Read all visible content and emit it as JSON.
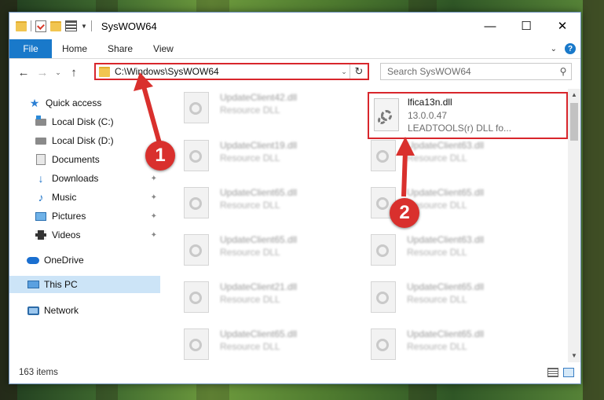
{
  "titlebar": {
    "title": "SysWOW64",
    "minimize": "—",
    "maximize": "☐",
    "close": "✕"
  },
  "ribbon": {
    "tabs": [
      "File",
      "Home",
      "Share",
      "View"
    ],
    "help": "?"
  },
  "nav": {
    "back": "←",
    "forward": "→",
    "recent": "⌄",
    "up": "↑",
    "address": "C:\\Windows\\SysWOW64",
    "refresh": "↻",
    "search_placeholder": "Search SysWOW64"
  },
  "sidebar": {
    "items": [
      {
        "label": "Quick access",
        "icon": "star-icon"
      },
      {
        "label": "Local Disk (C:)",
        "icon": "drive-icon"
      },
      {
        "label": "Local Disk (D:)",
        "icon": "drive-icon"
      },
      {
        "label": "Documents",
        "icon": "documents-icon"
      },
      {
        "label": "Downloads",
        "icon": "downloads-icon",
        "pinned": true
      },
      {
        "label": "Music",
        "icon": "music-icon",
        "pinned": true
      },
      {
        "label": "Pictures",
        "icon": "pictures-icon",
        "pinned": true
      },
      {
        "label": "Videos",
        "icon": "videos-icon",
        "pinned": true
      },
      {
        "label": "OneDrive",
        "icon": "cloud-icon"
      },
      {
        "label": "This PC",
        "icon": "computer-icon",
        "selected": true
      },
      {
        "label": "Network",
        "icon": "network-icon"
      }
    ],
    "pin_glyph": "📌"
  },
  "files": {
    "left": [
      {
        "name": "UpdateClient42.dll",
        "type": "Resource DLL"
      },
      {
        "name": "UpdateClient19.dll",
        "type": "Resource DLL"
      },
      {
        "name": "UpdateClient65.dll",
        "type": "Resource DLL"
      },
      {
        "name": "UpdateClient65.dll",
        "type": "Resource DLL"
      },
      {
        "name": "UpdateClient21.dll",
        "type": "Resource DLL"
      },
      {
        "name": "UpdateClient65.dll",
        "type": "Resource DLL"
      }
    ],
    "right": [
      {
        "name": "UpdateClient63.dll",
        "type": "Resource DLL"
      },
      {
        "name": "UpdateClient65.dll",
        "type": "Resource DLL"
      },
      {
        "name": "UpdateClient63.dll",
        "type": "Resource DLL"
      },
      {
        "name": "UpdateClient65.dll",
        "type": "Resource DLL"
      },
      {
        "name": "UpdateClient65.dll",
        "type": "Resource DLL"
      }
    ],
    "highlighted": {
      "name": "lfica13n.dll",
      "version": "13.0.0.47",
      "description": "LEADTOOLS(r) DLL fo..."
    }
  },
  "status": {
    "items_count": "163 items"
  },
  "annotations": {
    "marker1": "1",
    "marker2": "2",
    "color": "#d9302d"
  }
}
